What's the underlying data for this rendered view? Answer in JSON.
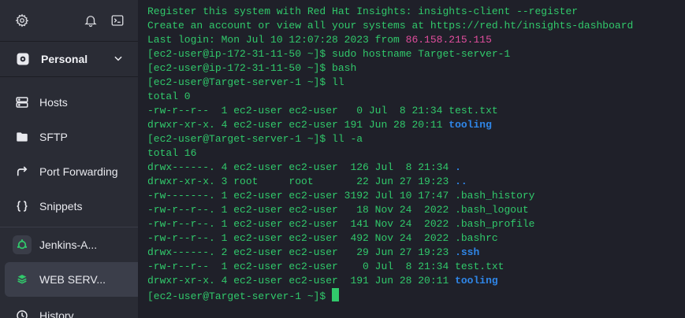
{
  "colors": {
    "sidebar_bg": "#2a2c35",
    "terminal_bg": "#1f2029",
    "terminal_text": "#31c96b",
    "ip_highlight": "#e04e9d",
    "directory": "#2f86e8",
    "accent_green": "#31c96b"
  },
  "sidebar": {
    "top_icons": [
      "gear-icon",
      "bell-icon",
      "terminal-icon"
    ],
    "vault": {
      "label": "Personal",
      "icon": "vault-icon"
    },
    "nav": [
      {
        "label": "Hosts",
        "icon": "hosts-icon"
      },
      {
        "label": "SFTP",
        "icon": "folder-icon"
      },
      {
        "label": "Port Forwarding",
        "icon": "port-forwarding-icon"
      },
      {
        "label": "Snippets",
        "icon": "braces-icon"
      }
    ],
    "hosts": [
      {
        "label": "Jenkins-A...",
        "icon": "ubuntu-icon",
        "active": false
      },
      {
        "label": "WEB SERV...",
        "icon": "server-icon",
        "active": true
      }
    ],
    "history_label": "History"
  },
  "terminal": {
    "prompt": "[ec2-user@Target-server-1 ~]$ ",
    "lines": [
      {
        "text": "Register this system with Red Hat Insights: insights-client --register"
      },
      {
        "text": "Create an account or view all your systems at https://red.ht/insights-dashboard"
      },
      {
        "text": "Last login: Mon Jul 10 12:07:28 2023 from ",
        "hl": "86.158.215.115",
        "hl_class": "hl-ip"
      },
      {
        "text": "[ec2-user@ip-172-31-11-50 ~]$ sudo hostname Target-server-1"
      },
      {
        "text": "[ec2-user@ip-172-31-11-50 ~]$ bash"
      },
      {
        "text": "[ec2-user@Target-server-1 ~]$ ll"
      },
      {
        "text": "total 0"
      },
      {
        "text": "-rw-r--r--  1 ec2-user ec2-user   0 Jul  8 21:34 test.txt"
      },
      {
        "text": "drwxr-xr-x. 4 ec2-user ec2-user 191 Jun 28 20:11 ",
        "hl": "tooling",
        "hl_class": "hl-dir"
      },
      {
        "text": "[ec2-user@Target-server-1 ~]$ ll -a"
      },
      {
        "text": "total 16"
      },
      {
        "text": "drwx------. 4 ec2-user ec2-user  126 Jul  8 21:34 ",
        "hl": ".",
        "hl_class": "hl-dir"
      },
      {
        "text": "drwxr-xr-x. 3 root     root       22 Jun 27 19:23 ",
        "hl": "..",
        "hl_class": "hl-dir"
      },
      {
        "text": "-rw-------. 1 ec2-user ec2-user 3192 Jul 10 17:47 .bash_history"
      },
      {
        "text": "-rw-r--r--. 1 ec2-user ec2-user   18 Nov 24  2022 .bash_logout"
      },
      {
        "text": "-rw-r--r--. 1 ec2-user ec2-user  141 Nov 24  2022 .bash_profile"
      },
      {
        "text": "-rw-r--r--. 1 ec2-user ec2-user  492 Nov 24  2022 .bashrc"
      },
      {
        "text": "drwx------. 2 ec2-user ec2-user   29 Jun 27 19:23 ",
        "hl": ".ssh",
        "hl_class": "hl-dir"
      },
      {
        "text": "-rw-r--r--  1 ec2-user ec2-user    0 Jul  8 21:34 test.txt"
      },
      {
        "text": "drwxr-xr-x. 4 ec2-user ec2-user  191 Jun 28 20:11 ",
        "hl": "tooling",
        "hl_class": "hl-dir"
      }
    ]
  }
}
